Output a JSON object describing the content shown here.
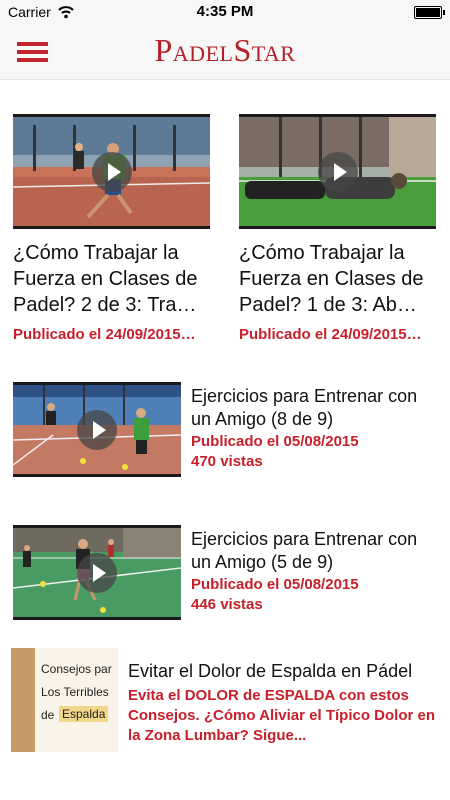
{
  "status_bar": {
    "carrier": "Carrier",
    "time": "4:35 PM",
    "icons": [
      "wifi-icon",
      "battery-icon"
    ]
  },
  "header": {
    "logo": "PadelStar",
    "menu_icon": "hamburger-menu-icon",
    "brand_color": "#c2242e"
  },
  "featured": [
    {
      "title_lines": [
        "¿Cómo Trabajar la",
        "Fuerza en Clases de",
        "Padel? 2 de 3: Tra…"
      ],
      "date": "Publicado el 24/09/2015…"
    },
    {
      "title_lines": [
        "¿Cómo Trabajar la",
        "Fuerza en Clases de",
        "Padel? 1 de 3: Ab…"
      ],
      "date": "Publicado el 24/09/2015…"
    }
  ],
  "videos": [
    {
      "title_lines": [
        "Ejercicios para Entrenar con",
        "un Amigo (8 de 9)"
      ],
      "date": "Publicado el 05/08/2015",
      "views": "470 vistas"
    },
    {
      "title_lines": [
        "Ejercicios para Entrenar con",
        "un Amigo (5 de 9)"
      ],
      "date": "Publicado el 05/08/2015",
      "views": "446 vistas"
    }
  ],
  "article": {
    "title": "Evitar el Dolor de Espalda en Pádel",
    "excerpt_lines": [
      "Evita el DOLOR de ESPALDA con estos",
      "Consejos. ¿Cómo Aliviar el Típico Dolor en",
      "la Zona Lumbar? Sigue..."
    ],
    "thumb_lines": [
      "Consejos par",
      "Los Terribles",
      "de",
      "Espalda"
    ]
  },
  "colors": {
    "accent_red": "#c8202b",
    "court_blue": "#3a6fb0",
    "court_green": "#3d8a5a"
  }
}
